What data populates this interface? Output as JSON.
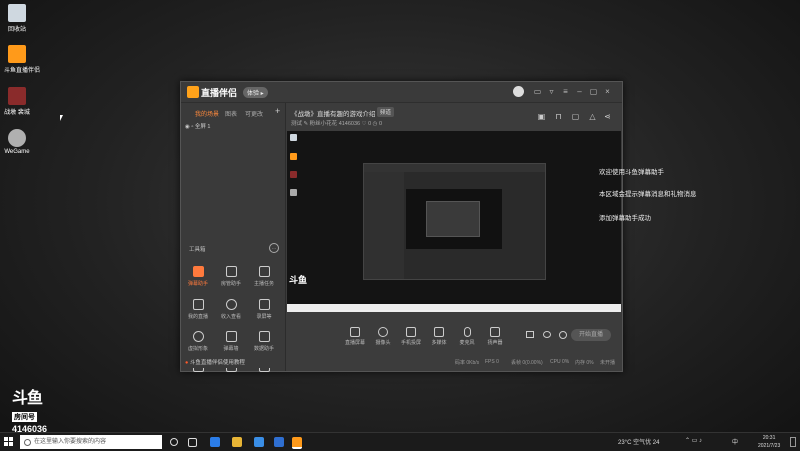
{
  "desktop_icons": [
    {
      "label": "回收站",
      "icon": "recycle-bin-icon",
      "color": "#cfd8e0"
    },
    {
      "label": "斗鱼直播伴侣",
      "icon": "douyu-companion-icon",
      "color": "#ff9a1a"
    },
    {
      "label": "战墩 裴城",
      "icon": "game-app-icon",
      "color": "#8a2b2b"
    },
    {
      "label": "WeGame",
      "icon": "wegame-icon",
      "color": "#b0b0b0"
    }
  ],
  "window": {
    "app_title": "直播伴侣",
    "badge": "体验 ▸",
    "left_tabs": [
      "我的场景",
      "图表",
      "可更改"
    ],
    "scene": "全屏 1",
    "add_label": "+",
    "toolbox_title": "工具箱",
    "tools": [
      {
        "label": "弹幕助手",
        "active": true
      },
      {
        "label": "房管助手",
        "active": false
      },
      {
        "label": "主播任务",
        "active": false
      },
      {
        "label": "我的直播",
        "active": false
      },
      {
        "label": "收入查看",
        "active": false
      },
      {
        "label": "录屏等",
        "active": false
      },
      {
        "label": "虚拟形象",
        "active": false
      },
      {
        "label": "弹幕墙",
        "active": false
      },
      {
        "label": "数据助手",
        "active": false
      },
      {
        "label": "",
        "active": false
      },
      {
        "label": "",
        "active": false
      },
      {
        "label": "",
        "active": false
      }
    ],
    "help_link": "斗鱼直播伴侣使用教程",
    "room_title": "《战墩》直播有趣的游戏介绍",
    "room_badge": "频道",
    "room_info": "测试  ✎  粉丝小花花  4146036  ♡ 0  ◷ 0",
    "bottom_tools": [
      "直播屏幕",
      "摄像头",
      "手机投屏",
      "多媒体",
      "麦克风",
      "扬声器"
    ],
    "start_button": "开始直播",
    "status_items": [
      "码率 0Kb/s",
      "FPS 0",
      "丢帧 0(0.00%)",
      "CPU 0%",
      "内存 0%",
      "未开播"
    ]
  },
  "messages": [
    "欢迎使用斗鱼弹幕助手",
    "本区域会提示弹幕消息和礼物消息",
    "添加弹幕助手成功"
  ],
  "watermark": {
    "logo": "斗鱼",
    "room_label": "房间号",
    "room_number": "4146036"
  },
  "taskbar": {
    "search_placeholder": "在这里输入你要搜索的内容",
    "weather": "23°C 空气优 24",
    "time": "20:31",
    "date": "2021/7/23",
    "lang": "中"
  },
  "colors": {
    "accent": "#ff7a3d",
    "window_bg": "#3c3c3c"
  }
}
